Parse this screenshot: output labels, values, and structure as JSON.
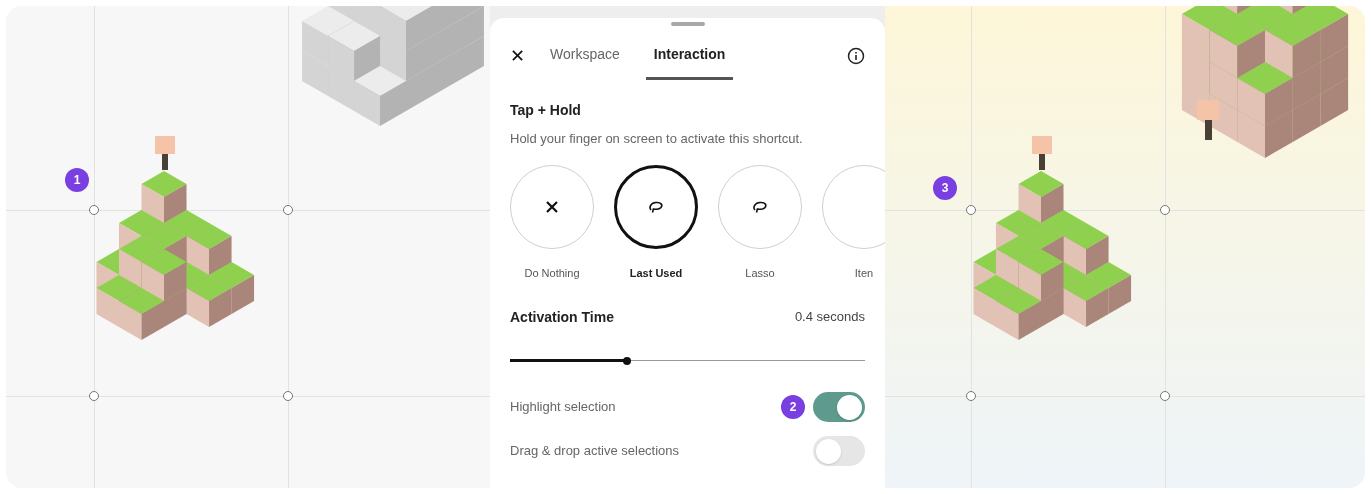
{
  "left_canvas": {
    "badge": "1"
  },
  "panel": {
    "close": "✕",
    "tabs": [
      {
        "label": "Workspace",
        "selected": false
      },
      {
        "label": "Interaction",
        "selected": true
      }
    ],
    "title": "Tap + Hold",
    "description": "Hold your finger on screen to activate this shortcut.",
    "options": [
      {
        "label": "Do Nothing",
        "kind": "none",
        "selected": false
      },
      {
        "label": "Last Used",
        "kind": "lasso",
        "selected": true
      },
      {
        "label": "Lasso",
        "kind": "lasso",
        "selected": false
      },
      {
        "label": "Iten",
        "kind": "blank",
        "selected": false
      }
    ],
    "activation": {
      "label": "Activation Time",
      "value": "0.4 seconds",
      "level": 0.33
    },
    "toggles": [
      {
        "label": "Highlight selection",
        "on": true,
        "badge": "2"
      },
      {
        "label": "Drag & drop active selections",
        "on": false
      }
    ]
  },
  "right_canvas": {
    "badge": "3"
  }
}
